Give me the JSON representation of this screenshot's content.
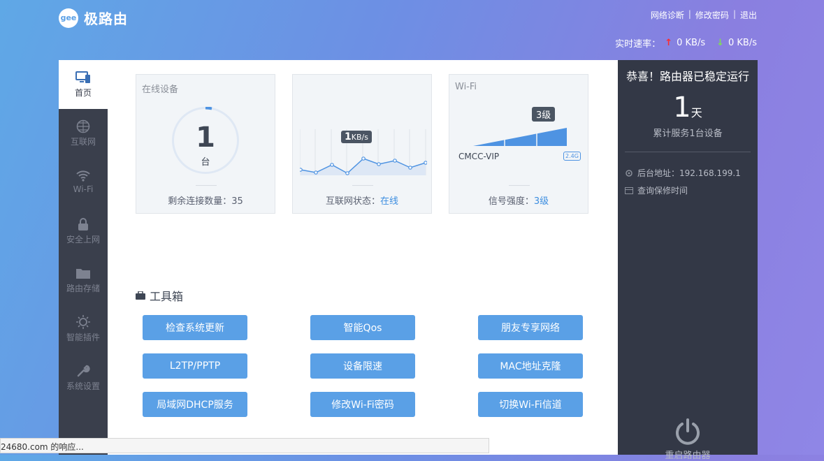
{
  "header": {
    "logo_badge": "gee",
    "brand": "极路由",
    "links": [
      "网络诊断",
      "修改密码",
      "退出"
    ],
    "speed_label": "实时速率：",
    "upload": "0 KB/s",
    "download": "0 KB/s"
  },
  "sidebar": {
    "items": [
      {
        "label": "首页",
        "icon": "monitor-icon"
      },
      {
        "label": "互联网",
        "icon": "globe-icon"
      },
      {
        "label": "Wi-Fi",
        "icon": "wifi-icon"
      },
      {
        "label": "安全上网",
        "icon": "lock-icon"
      },
      {
        "label": "路由存储",
        "icon": "folder-icon"
      },
      {
        "label": "智能插件",
        "icon": "bulb-icon"
      },
      {
        "label": "系统设置",
        "icon": "wrench-icon"
      }
    ]
  },
  "cards": {
    "devices": {
      "title": "在线设备",
      "count": "1",
      "unit": "台",
      "footer": "剩余连接数量：35"
    },
    "internet": {
      "speed_value": "1",
      "speed_unit": "KB/s",
      "footer_label": "互联网状态：",
      "footer_value": "在线"
    },
    "wifi": {
      "title": "Wi-Fi",
      "level": "3级",
      "ssid": "CMCC-VIP",
      "band": "2.4G",
      "footer_label": "信号强度：",
      "footer_value": "3级"
    }
  },
  "tools": {
    "title": "工具箱",
    "buttons": [
      "检查系统更新",
      "智能Qos",
      "朋友专享网络",
      "L2TP/PPTP",
      "设备限速",
      "MAC地址克隆",
      "局域网DHCP服务",
      "修改Wi-Fi密码",
      "切换Wi-Fi信道"
    ]
  },
  "status_panel": {
    "title": "恭喜！路由器已稳定运行",
    "days": "1",
    "days_unit": "天",
    "served": "累计服务1台设备",
    "admin_address": "后台地址：192.168.199.1",
    "warranty": "查询保修时间",
    "restart": "重启路由器"
  },
  "statusbar": {
    "text": "24680.com 的响应..."
  },
  "colors": {
    "accent": "#5aa0e6",
    "sidebar": "#3a3f4c",
    "right_panel": "#333846",
    "upload_arrow": "#ff2b2b",
    "download_arrow": "#7fdd55"
  }
}
